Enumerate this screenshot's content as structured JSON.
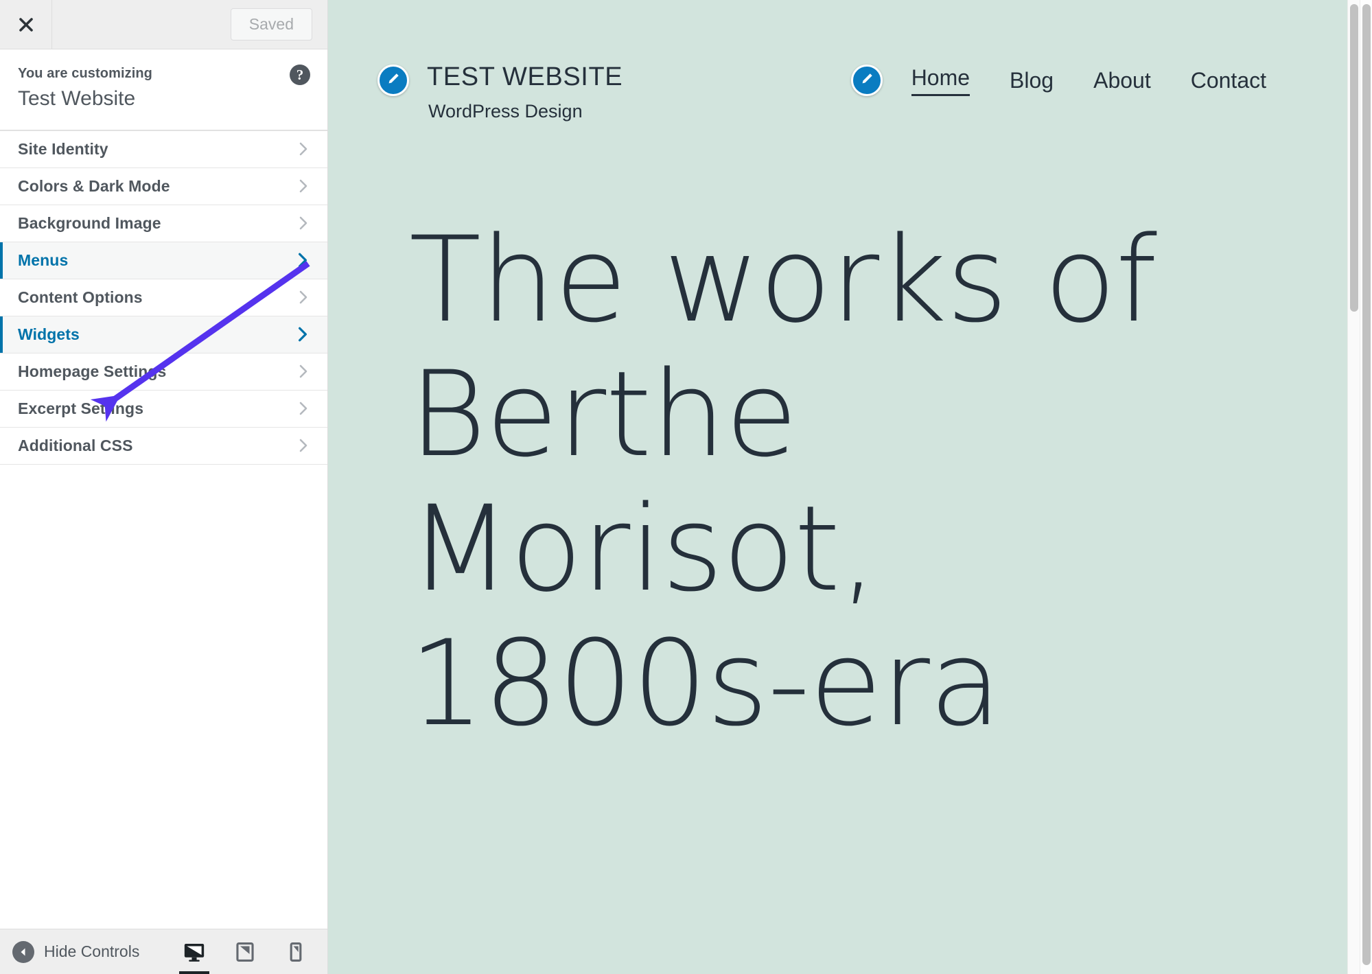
{
  "customizer": {
    "topbar": {
      "close_icon": "close-x-icon",
      "save_label": "Saved"
    },
    "header": {
      "eyebrow": "You are customizing",
      "site_title": "Test Website",
      "help_label": "?"
    },
    "sections": [
      {
        "label": "Site Identity",
        "active": false
      },
      {
        "label": "Colors & Dark Mode",
        "active": false
      },
      {
        "label": "Background Image",
        "active": false
      },
      {
        "label": "Menus",
        "active": true
      },
      {
        "label": "Content Options",
        "active": false
      },
      {
        "label": "Widgets",
        "active": true
      },
      {
        "label": "Homepage Settings",
        "active": false
      },
      {
        "label": "Excerpt Settings",
        "active": false
      },
      {
        "label": "Additional CSS",
        "active": false
      }
    ],
    "bottombar": {
      "hide_controls_label": "Hide Controls",
      "devices": [
        {
          "name": "desktop",
          "active": true
        },
        {
          "name": "tablet",
          "active": false
        },
        {
          "name": "mobile",
          "active": false
        }
      ]
    },
    "colors": {
      "accent_blue": "#0073aa",
      "panel_bg": "#ffffff",
      "bar_bg": "#eeeeee",
      "text": "#50575e"
    }
  },
  "preview": {
    "brand": {
      "title": "TEST WEBSITE",
      "tagline": "WordPress Design",
      "edit_pin_icon": "pencil-edit-icon"
    },
    "nav": {
      "edit_pin_icon": "pencil-edit-icon",
      "items": [
        {
          "label": "Home",
          "current": true
        },
        {
          "label": "Blog",
          "current": false
        },
        {
          "label": "About",
          "current": false
        },
        {
          "label": "Contact",
          "current": false
        }
      ]
    },
    "hero": {
      "title": "The works of Berthe Morisot, 1800s-era"
    },
    "colors": {
      "background": "#d2e4dd",
      "text": "#25303b",
      "pin_blue": "#0a7cc1"
    }
  },
  "annotation": {
    "arrow_color": "#5533ee",
    "points_to": "Widgets"
  }
}
